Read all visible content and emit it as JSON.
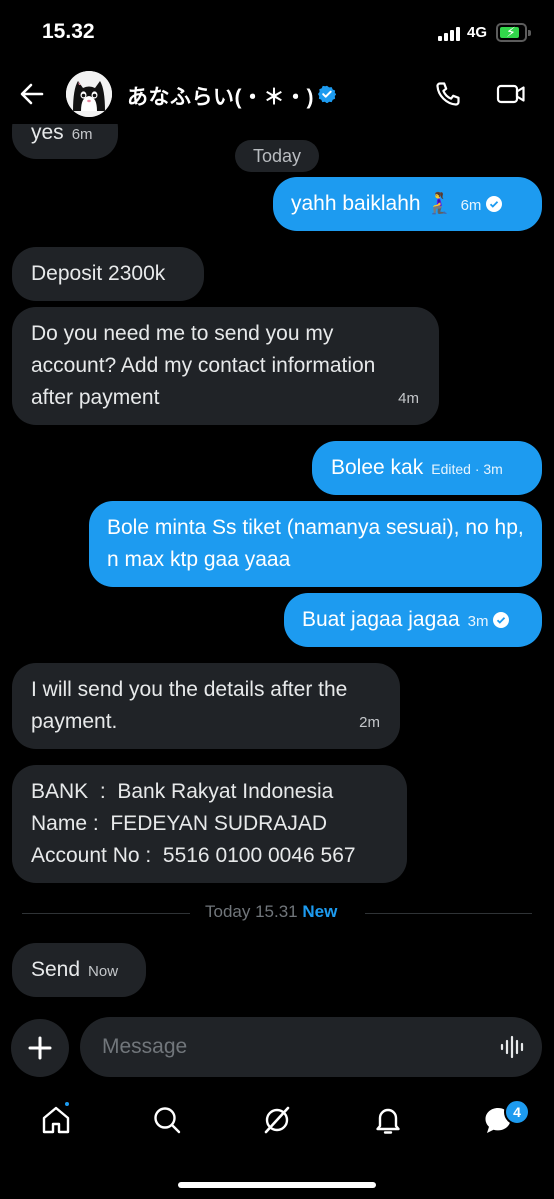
{
  "status_bar": {
    "time": "15.32",
    "network": "4G"
  },
  "header": {
    "contact_name": "あなふらい(・＊・)"
  },
  "chat": {
    "day_label": "Today",
    "messages": [
      {
        "text": "yes",
        "time": "6m"
      },
      {
        "text": "yahh baiklahh 🧎‍♀️",
        "time": "6m"
      },
      {
        "text": "Deposit 2300k",
        "time": ""
      },
      {
        "text": "Do you need me to send you my account? Add my contact information after payment",
        "time": "4m"
      },
      {
        "text": "Bolee kak",
        "time": "Edited · 3m"
      },
      {
        "text": "Bole minta Ss tiket (namanya sesuai), no hp, n max ktp gaa yaaa",
        "time": ""
      },
      {
        "text": "Buat jagaa jagaa",
        "time": "3m"
      },
      {
        "text": "I will send you the details after the payment.",
        "time": "2m"
      },
      {
        "text": "BANK  :  Bank Rakyat Indonesia\nName :  FEDEYAN SUDRAJAD\nAccount No :  5516 0100 0046 567",
        "time": ""
      },
      {
        "text": "Send",
        "time": "Now"
      }
    ],
    "divider": {
      "label": "Today 15.31",
      "new_label": "New"
    }
  },
  "composer": {
    "placeholder": "Message"
  },
  "nav": {
    "messages_badge": "4"
  },
  "colors": {
    "accent": "#1d9bf0",
    "incoming_bubble": "#202327",
    "background": "#000000"
  }
}
